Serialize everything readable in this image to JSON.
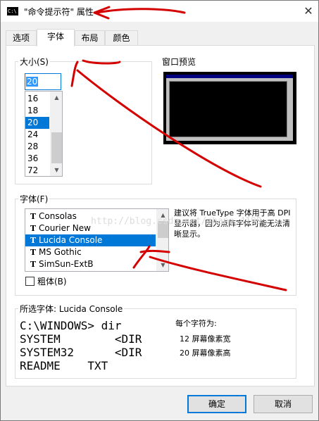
{
  "window": {
    "title": "\"命令提示符\" 属性",
    "icon_text": "C:\\",
    "close_glyph": "✕"
  },
  "tabs": [
    {
      "label": "选项"
    },
    {
      "label": "字体"
    },
    {
      "label": "布局"
    },
    {
      "label": "颜色"
    }
  ],
  "active_tab": "字体",
  "size_group": {
    "label": "大小(S)",
    "current_value": "20",
    "items": [
      "16",
      "18",
      "20",
      "24",
      "28",
      "36",
      "72"
    ],
    "selected": "20"
  },
  "preview": {
    "label": "窗口预览"
  },
  "font_group": {
    "label": "字体(F)",
    "items": [
      {
        "icon": "truetype-icon",
        "name": "Consolas"
      },
      {
        "icon": "truetype-icon",
        "name": "Courier New"
      },
      {
        "icon": "truetype-icon",
        "name": "Lucida Console"
      },
      {
        "icon": "truetype-icon",
        "name": "MS Gothic"
      },
      {
        "icon": "truetype-icon",
        "name": "SimSun-ExtB"
      }
    ],
    "selected": "Lucida Console",
    "hint": "建议将 TrueType 字体用于高 DPI 显示器，因为点阵字体可能无法清晰显示。",
    "bold_label": "粗体(B)",
    "bold_checked": false
  },
  "selected_font": {
    "label": "所选字体: Lucida Console",
    "sample_lines": [
      "C:\\WINDOWS> dir",
      "SYSTEM        <DIR",
      "SYSTEM32      <DIR",
      "README    TXT"
    ],
    "char_size_label": "每个字符为:",
    "char_width": "12 屏幕像素宽",
    "char_height": "20 屏幕像素高"
  },
  "watermark": "http://blog.csdn.net/zhang_4199",
  "buttons": {
    "ok": "确定",
    "cancel": "取消"
  },
  "colors": {
    "selection": "#0078d7",
    "annotation": "#d40000"
  }
}
